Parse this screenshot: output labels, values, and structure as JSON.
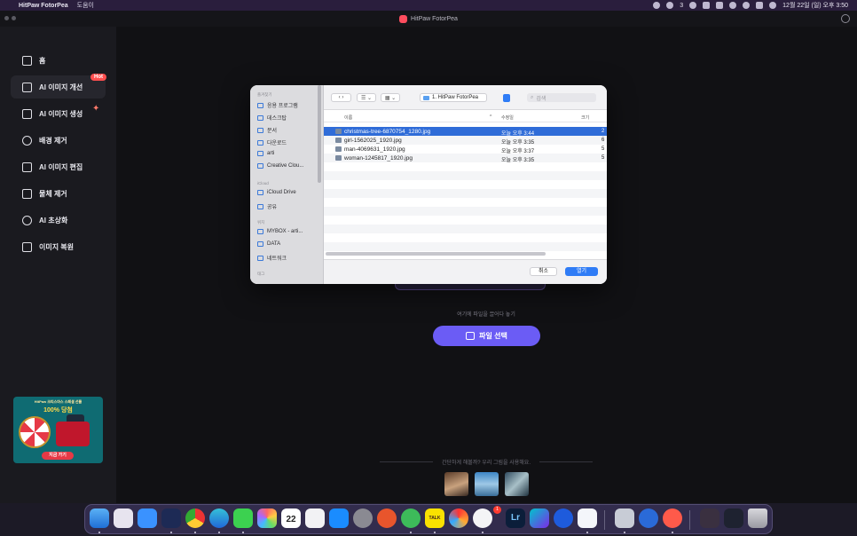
{
  "menubar": {
    "app_name": "HitPaw FotorPea",
    "menu_help": "도움이",
    "status_count": "3",
    "datetime": "12월 22일 (일) 오후 3:50"
  },
  "titlebar": {
    "title": "HitPaw FotorPea"
  },
  "sidebar": {
    "items": [
      {
        "label": "홈",
        "icon": "home-icon"
      },
      {
        "label": "AI 이미지 개선",
        "icon": "image-enhance-icon"
      },
      {
        "label": "AI 이미지 생성",
        "icon": "magic-wand-icon"
      },
      {
        "label": "배경 제거",
        "icon": "background-remove-icon"
      },
      {
        "label": "AI 이미지 편집",
        "icon": "image-edit-icon"
      },
      {
        "label": "물체 제거",
        "icon": "eraser-icon"
      },
      {
        "label": "AI 초상화",
        "icon": "portrait-icon"
      },
      {
        "label": "이미지 복원",
        "icon": "restore-icon"
      }
    ],
    "hot_badge": "Hot",
    "promo": {
      "title": "HitPaw 크리스마스 스페셜 선물",
      "headline": "100% 당첨",
      "button": "지금 가기"
    }
  },
  "main": {
    "drop_hint": "여기에 파일을 끌어다 놓기",
    "file_select_button": "파일 선택",
    "sample_hint": "간단하게 해볼까? 우리 그림을 사용해요."
  },
  "dialog": {
    "sidebar": {
      "favorites_header": "즐겨찾기",
      "favorites": [
        "응용 프로그램",
        "데스크탑",
        "문서",
        "다운로드",
        "arti",
        "Creative Clou..."
      ],
      "icloud_header": "iCloud",
      "icloud": [
        "iCloud Drive",
        "공유"
      ],
      "locations_header": "위치",
      "locations": [
        "MYBOX - arti...",
        "DATA",
        "네트워크"
      ],
      "tags_header": "태그"
    },
    "location": "1. HitPaw FotorPea",
    "search_placeholder": "검색",
    "columns": {
      "name": "이름",
      "date": "수정일",
      "size": "크기"
    },
    "files": [
      {
        "name": "christmas-tree-6870754_1280.jpg",
        "date": "오늘 오후 3:44",
        "size": "2",
        "selected": true
      },
      {
        "name": "girl-1562025_1920.jpg",
        "date": "오늘 오후 3:35",
        "size": "6",
        "selected": false
      },
      {
        "name": "man-4069631_1920.jpg",
        "date": "오늘 오후 3:37",
        "size": "5",
        "selected": false
      },
      {
        "name": "woman-1245817_1920.jpg",
        "date": "오늘 오후 3:35",
        "size": "5",
        "selected": false
      }
    ],
    "cancel_button": "취소",
    "open_button": "열기"
  },
  "dock": {
    "calendar_month": "12월",
    "calendar_day": "22",
    "kakao_label": "TALK",
    "notification_badge": "1"
  },
  "colors": {
    "accent": "#6b5cf5",
    "selection": "#2f6cd8",
    "hot": "#ff4f4f"
  }
}
